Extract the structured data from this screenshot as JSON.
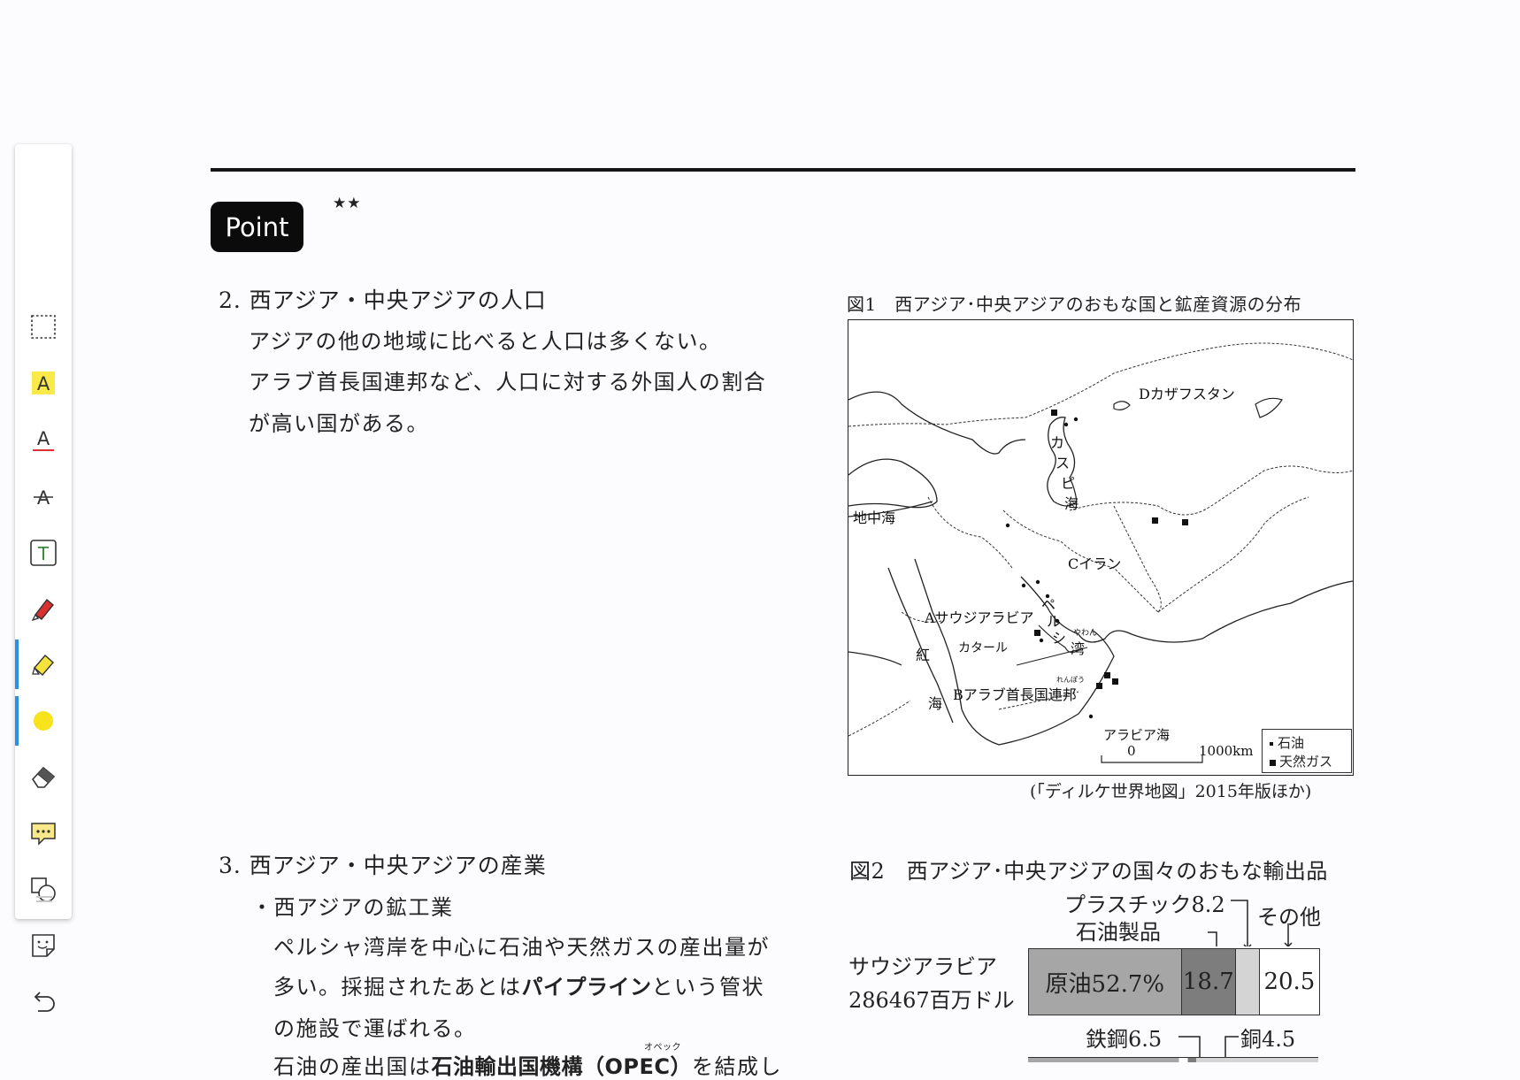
{
  "toolbar": {
    "items": [
      {
        "name": "select",
        "icon": "dashed-select-icon"
      },
      {
        "name": "text-highlight",
        "icon": "highlight-a-icon"
      },
      {
        "name": "text-underline",
        "icon": "underline-a-icon"
      },
      {
        "name": "text-strikethrough",
        "icon": "strikethrough-a-icon"
      },
      {
        "name": "text-box",
        "icon": "text-box-icon"
      },
      {
        "name": "pen",
        "icon": "pen-icon"
      },
      {
        "name": "highlighter",
        "icon": "highlighter-icon",
        "active": true
      },
      {
        "name": "color",
        "icon": "color-dot-icon",
        "color": "#f7e21b"
      },
      {
        "name": "eraser",
        "icon": "eraser-icon"
      },
      {
        "name": "comment",
        "icon": "comment-icon"
      },
      {
        "name": "shape",
        "icon": "shape-icon"
      },
      {
        "name": "sticker",
        "icon": "sticker-icon"
      },
      {
        "name": "undo",
        "icon": "undo-icon"
      }
    ]
  },
  "page": {
    "badge": "Point",
    "stars": "★★",
    "section2": {
      "heading": "2. 西アジア・中央アジアの人口",
      "lines": [
        "アジアの他の地域に比べると人口は多くない。",
        "アラブ首長国連邦など、人口に対する外国人の割合",
        "が高い国がある。"
      ]
    },
    "fig1": {
      "title": "図1　西アジア･中央アジアのおもな国と鉱産資源の分布",
      "labels": {
        "kazakhstan": "Dカザフスタン",
        "caspian": [
          "カ",
          "ス",
          "ピ",
          "海"
        ],
        "mediterranean": "地中海",
        "iran": "Cイラン",
        "saudi": "Aサウジアラビア",
        "persian": [
          "ペ",
          "ル",
          "シ"
        ],
        "persian_ruby": "やわん",
        "persian_bay": "湾",
        "qatar": "カタール",
        "red_sea": [
          "紅",
          "海"
        ],
        "uae": "Bアラブ首長国連邦",
        "uae_ruby": "れんぽう",
        "arabian_sea": "アラビア海",
        "scale_zero": "0",
        "scale_km": "1000km",
        "legend_oil": "石油",
        "legend_gas": "天然ガス"
      },
      "source": "(「ディルケ世界地図」2015年版ほか)"
    },
    "section3": {
      "heading": "3. 西アジア・中央アジアの産業",
      "subheading": "・西アジアの鉱工業",
      "line1": "ペルシャ湾岸を中心に石油や天然ガスの産出量が",
      "line2_pre": "多い。採掘されたあとは",
      "line2_bold": "パイプライン",
      "line2_post": "という管状",
      "line3": "の施設で運ばれる。",
      "line4_pre": "石油の産出国は",
      "line4_bold": "石油輸出国機構",
      "line4_paren": "（OPEC）",
      "line4_post": "を結成し",
      "opec_ruby": "オペック"
    },
    "fig2": {
      "title": "図2　西アジア･中央アジアの国々のおもな輸出品",
      "ann_plastic": "プラスチック8.2",
      "ann_petro": "石油製品",
      "ann_other": "その他",
      "country": "サウジアラビア",
      "total": "286467百万ドル",
      "ann_steel": "鉄鋼6.5",
      "ann_copper": "銅4.5"
    }
  },
  "chart_data": {
    "type": "bar",
    "title": "図2　西アジア･中央アジアの国々のおもな輸出品",
    "categories": [
      "サウジアラビア"
    ],
    "series": [
      {
        "name": "原油",
        "values": [
          52.7
        ]
      },
      {
        "name": "石油製品",
        "values": [
          18.7
        ]
      },
      {
        "name": "プラスチック",
        "values": [
          8.2
        ]
      },
      {
        "name": "その他",
        "values": [
          20.5
        ]
      }
    ],
    "segment_labels": [
      "原油52.7%",
      "18.7",
      "",
      "20.5"
    ],
    "colors": [
      "#a6a6a6",
      "#7d7d7d",
      "#d4d4d4",
      "#ffffff"
    ],
    "unit": "%"
  }
}
